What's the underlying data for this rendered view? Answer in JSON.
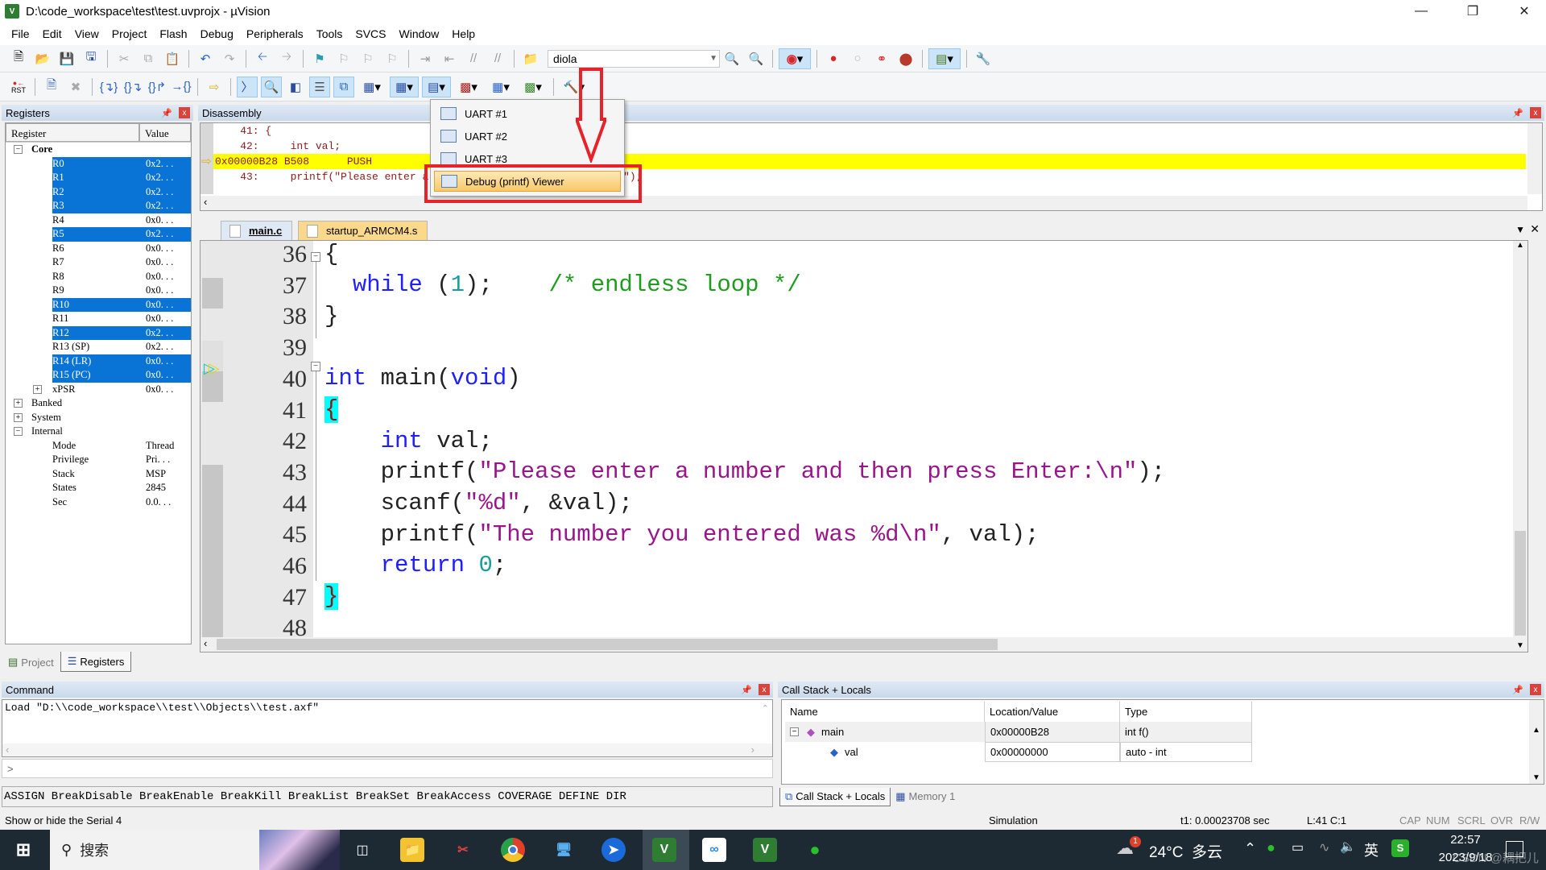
{
  "window": {
    "title": "D:\\code_workspace\\test\\test.uvprojx - µVision",
    "app_icon": "uvision-icon",
    "controls": [
      "minimize",
      "restore",
      "close"
    ]
  },
  "menu": [
    "File",
    "Edit",
    "View",
    "Project",
    "Flash",
    "Debug",
    "Peripherals",
    "Tools",
    "SVCS",
    "Window",
    "Help"
  ],
  "toolbar1": {
    "target_combo": "diola"
  },
  "toolbar2": {
    "reset_label": "RST"
  },
  "registers": {
    "title": "Registers",
    "columns": [
      "Register",
      "Value"
    ],
    "core_label": "Core",
    "rows": [
      {
        "name": "R0",
        "value": "0x2. . .",
        "selected": true
      },
      {
        "name": "R1",
        "value": "0x2. . .",
        "selected": true
      },
      {
        "name": "R2",
        "value": "0x2. . .",
        "selected": true
      },
      {
        "name": "R3",
        "value": "0x2. . .",
        "selected": true
      },
      {
        "name": "R4",
        "value": "0x0. . .",
        "selected": false
      },
      {
        "name": "R5",
        "value": "0x2. . .",
        "selected": true
      },
      {
        "name": "R6",
        "value": "0x0. . .",
        "selected": false
      },
      {
        "name": "R7",
        "value": "0x0. . .",
        "selected": false
      },
      {
        "name": "R8",
        "value": "0x0. . .",
        "selected": false
      },
      {
        "name": "R9",
        "value": "0x0. . .",
        "selected": false
      },
      {
        "name": "R10",
        "value": "0x0. . .",
        "selected": true
      },
      {
        "name": "R11",
        "value": "0x0. . .",
        "selected": false
      },
      {
        "name": "R12",
        "value": "0x2. . .",
        "selected": true
      },
      {
        "name": "R13 (SP)",
        "value": "0x2. . .",
        "selected": false
      },
      {
        "name": "R14 (LR)",
        "value": "0x0. . .",
        "selected": true
      },
      {
        "name": "R15 (PC)",
        "value": "0x0. . .",
        "selected": true
      },
      {
        "name": "xPSR",
        "value": "0x0. . .",
        "selected": false
      }
    ],
    "groups": [
      "Banked",
      "System",
      "Internal"
    ],
    "internal": [
      {
        "name": "Mode",
        "value": "Thread"
      },
      {
        "name": "Privilege",
        "value": "Pri. . ."
      },
      {
        "name": "Stack",
        "value": "MSP"
      },
      {
        "name": "States",
        "value": "2845"
      },
      {
        "name": "Sec",
        "value": "0.0. . ."
      }
    ],
    "tabs": [
      "Project",
      "Registers"
    ]
  },
  "disassembly": {
    "title": "Disassembly",
    "lines": [
      "    41: {",
      "    42:     int val;",
      "0x00000B28 B508      PUSH",
      "    43:     printf(\"Please enter a number and then press Enter:\\n\");"
    ]
  },
  "popup_menu": {
    "items": [
      "UART #1",
      "UART #2",
      "UART #3",
      "Debug (printf) Viewer"
    ],
    "highlighted": "Debug (printf) Viewer"
  },
  "editor": {
    "tabs": [
      {
        "label": "main.c",
        "active": true
      },
      {
        "label": "startup_ARMCM4.s",
        "active": false
      }
    ],
    "line_numbers": [
      "36",
      "37",
      "38",
      "39",
      "40",
      "41",
      "42",
      "43",
      "44",
      "45",
      "46",
      "47",
      "48"
    ],
    "lines": {
      "l36": "{",
      "l37_kw": "while",
      "l37_a": " (",
      "l37_num": "1",
      "l37_b": ");",
      "l37_cm": "/* endless loop */",
      "l38": "}",
      "l40_kw": "int",
      "l40_a": " main(",
      "l40_kw2": "void",
      "l40_b": ")",
      "l41": "{",
      "l42_kw": "int",
      "l42_a": " val;",
      "l43_a": "printf(",
      "l43_st": "\"Please enter a number and then press Enter:\\n\"",
      "l43_b": ");",
      "l44_a": "scanf(",
      "l44_st": "\"%d\"",
      "l44_b": ", &val);",
      "l45_a": "printf(",
      "l45_st": "\"The number you entered was %d\\n\"",
      "l45_b": ", val);",
      "l46_kw": "return",
      "l46_num": "0",
      "l46_b": ";",
      "l47": "}"
    },
    "current_line": "41"
  },
  "command": {
    "title": "Command",
    "output": "Load \"D:\\\\code_workspace\\\\test\\\\Objects\\\\test.axf\"",
    "prompt": ">",
    "input_value": "",
    "hints": "ASSIGN BreakDisable BreakEnable BreakKill BreakList BreakSet BreakAccess COVERAGE DEFINE DIR"
  },
  "callstack": {
    "title": "Call Stack + Locals",
    "columns": [
      "Name",
      "Location/Value",
      "Type"
    ],
    "rows": [
      {
        "name": "main",
        "value": "0x00000B28",
        "type": "int f()"
      },
      {
        "name": "val",
        "value": "0x00000000",
        "type": "auto - int"
      }
    ],
    "tabs": [
      "Call Stack + Locals",
      "Memory 1"
    ]
  },
  "status": {
    "hint": "Show or hide the Serial 4",
    "mode": "Simulation",
    "time": "t1: 0.00023708 sec",
    "position": "L:41 C:1",
    "indicators": [
      "CAP",
      "NUM",
      "SCRL",
      "OVR",
      "R/W"
    ]
  },
  "taskbar": {
    "search_label": "搜索",
    "weather": "24°C  多云",
    "weather_badge": "1",
    "ime": "英",
    "time": "22:57",
    "date": "2023/9/18",
    "watermark": "CSDN @耦把儿"
  },
  "colors": {
    "selection": "#0a74d6",
    "exec_line": "#ffff00",
    "annotation": "#e8222a"
  }
}
